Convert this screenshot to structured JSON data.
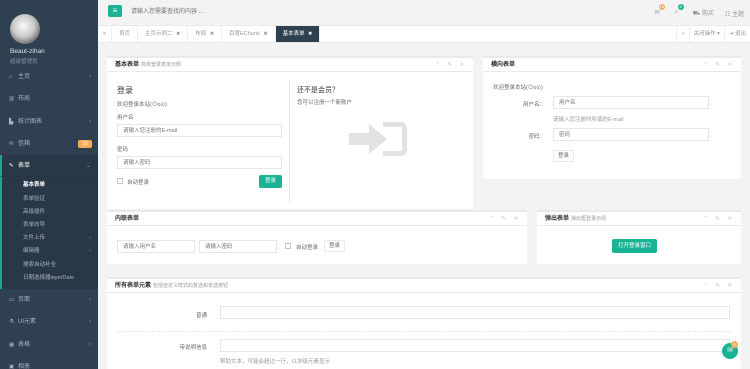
{
  "profile": {
    "name": "Beaut-zihan",
    "role": "超级管理员"
  },
  "nav": {
    "home": "主页",
    "layout": "布局",
    "charts": "统计图表",
    "mailbox": "信箱",
    "mailbox_badge": "16",
    "forms": "表单",
    "pages": "页面",
    "ui": "UI元素",
    "tables": "表格",
    "gallery": "相册"
  },
  "forms_sub": [
    "基本表单",
    "表单验证",
    "高级插件",
    "表单向导",
    "文件上传",
    "编辑器",
    "搜索自动补全",
    "日期选择器layerDate"
  ],
  "topbar": {
    "search_placeholder": "请输入您需要查找的内容 …",
    "badge_messages": "16",
    "badge_tasks": "8",
    "theme": "购买",
    "theme2": "主题"
  },
  "tabs": [
    "首页",
    "主页示例二",
    "布局",
    "百度ECharts",
    "基本表单"
  ],
  "tab_right": [
    "关闭操作",
    "退出"
  ],
  "basic_form": {
    "title": "基本表单",
    "title_sub": "简单登录表单示例",
    "heading": "登录",
    "desc": "欢迎登录本站(⊙o⊙)",
    "user_label": "用户名",
    "user_placeholder": "请输入您注册的E-mail",
    "pwd_label": "密码",
    "pwd_placeholder": "请输入密码",
    "remember": "自动登录",
    "submit": "登录",
    "right_heading": "还不是会员？",
    "right_text": "您可以注册一个新账户"
  },
  "horizontal_form": {
    "title": "横向表单",
    "desc": "欢迎登录本站(⊙o⊙)",
    "user_label": "用户名：",
    "user_placeholder": "用户名",
    "user_help": "请输入您注册时所填的E-mail",
    "pwd_label": "密码：",
    "pwd_placeholder": "密码",
    "submit": "登录"
  },
  "inline_form": {
    "title": "内联表单",
    "user_placeholder": "请输入用户名",
    "pwd_placeholder": "请输入密码",
    "remember": "自动登录",
    "submit": "登录"
  },
  "modal_form": {
    "title": "弹出表单",
    "title_sub": "弹出框登录示例",
    "button": "打开登录窗口"
  },
  "all_elements": {
    "title": "所有表单元素",
    "title_sub": "包括自定义样式的复选和单选按钮",
    "normal_label": "普通",
    "help_label": "带说明信息",
    "help_text": "帮助文本，可能会超过一行，以块级元素显示"
  },
  "chat_badge": "5"
}
